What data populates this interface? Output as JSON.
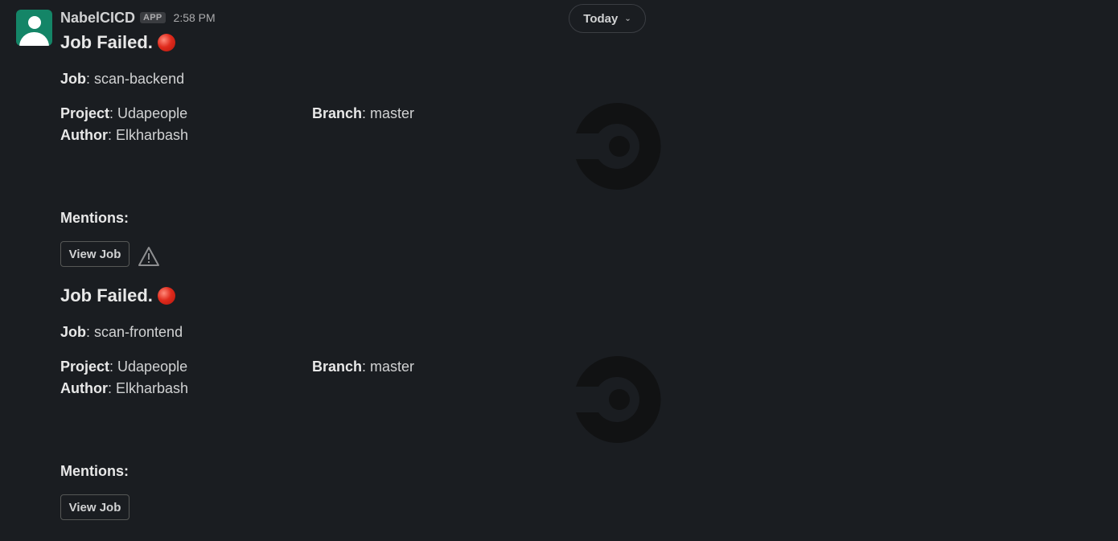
{
  "sender": {
    "name": "NabelCICD",
    "badge": "APP",
    "time": "2:58 PM"
  },
  "date_divider": {
    "label": "Today"
  },
  "jobs": [
    {
      "title": "Job Failed.",
      "job_label": "Job",
      "job_value": ": scan-backend",
      "project_label": "Project",
      "project_value": ": Udapeople",
      "branch_label": "Branch",
      "branch_value": ": master",
      "author_label": "Author",
      "author_value": ": Elkharbash",
      "mentions_label": "Mentions:",
      "button_label": "View Job"
    },
    {
      "title": "Job Failed.",
      "job_label": "Job",
      "job_value": ": scan-frontend",
      "project_label": "Project",
      "project_value": ": Udapeople",
      "branch_label": "Branch",
      "branch_value": ": master",
      "author_label": "Author",
      "author_value": ": Elkharbash",
      "mentions_label": "Mentions:",
      "button_label": "View Job"
    }
  ],
  "colors": {
    "background": "#1a1d21",
    "avatar": "#148567",
    "status_red": "#e02b1d",
    "logo": "#111213"
  },
  "icons": {
    "avatar": "user-avatar-icon",
    "status": "red-circle-icon",
    "logo": "circleci-logo-icon",
    "warning": "warning-triangle-icon",
    "chevron": "chevron-down-icon"
  }
}
